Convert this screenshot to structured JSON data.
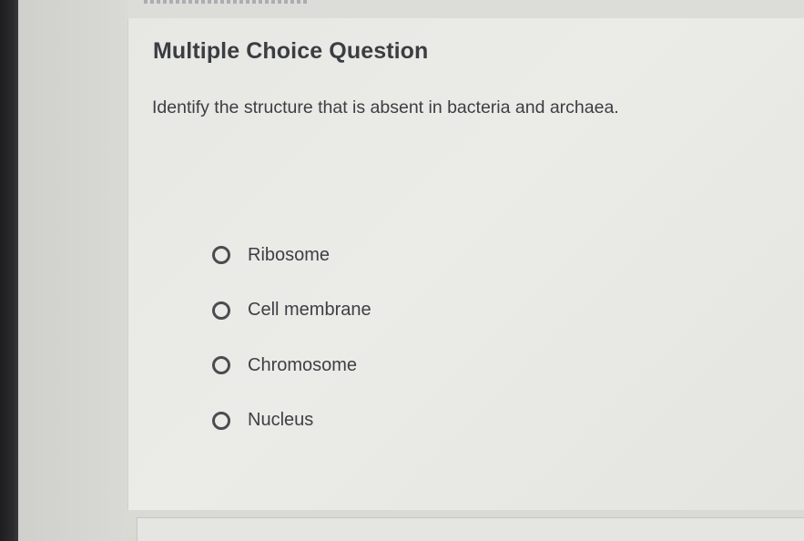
{
  "question_card": {
    "heading": "Multiple Choice Question",
    "prompt": "Identify the structure that is absent in bacteria and archaea.",
    "options": [
      {
        "label": "Ribosome",
        "selected": false
      },
      {
        "label": "Cell membrane",
        "selected": false
      },
      {
        "label": "Chromosome",
        "selected": false
      },
      {
        "label": "Nucleus",
        "selected": false
      }
    ]
  },
  "colors": {
    "text": "#3c3e43",
    "radio_border": "#4a4c50",
    "card_background": "#e7e7e3",
    "bezel": "#1e1d1f"
  },
  "icons": {
    "option_marker": "radio-unselected-icon"
  }
}
